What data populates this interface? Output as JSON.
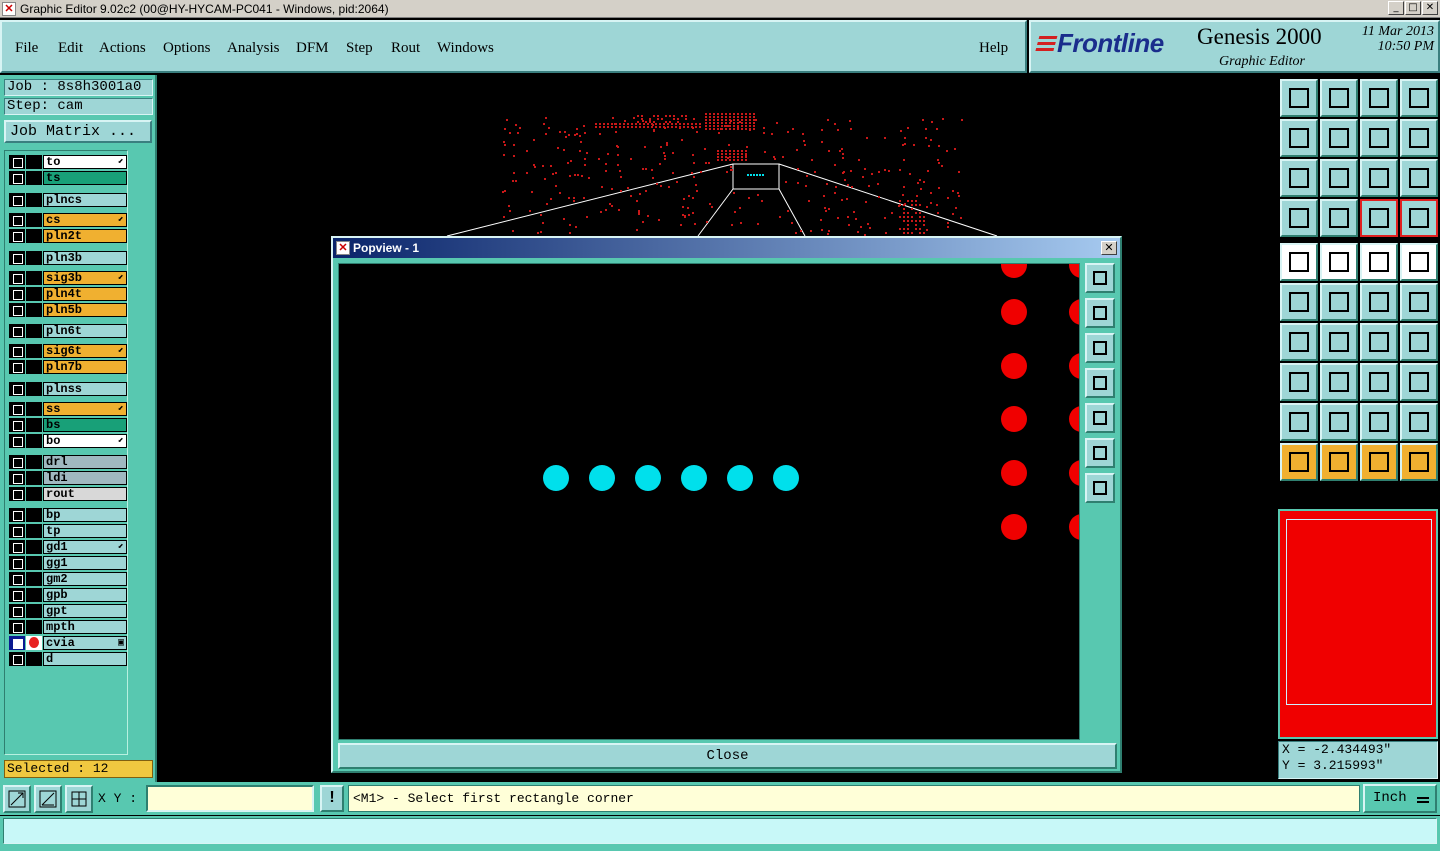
{
  "window": {
    "title": "Graphic Editor 9.02c2 (00@HY-HYCAM-PC041 - Windows, pid:2064)",
    "minimize": "_",
    "maximize": "□",
    "close": "✕"
  },
  "menu": [
    {
      "label": "File"
    },
    {
      "label": "Edit"
    },
    {
      "label": "Actions"
    },
    {
      "label": "Options"
    },
    {
      "label": "Analysis"
    },
    {
      "label": "DFM"
    },
    {
      "label": "Step"
    },
    {
      "label": "Rout"
    },
    {
      "label": "Windows"
    }
  ],
  "help_label": "Help",
  "brand": {
    "logo": "Frontline",
    "product": "Genesis 2000",
    "subtitle": "Graphic Editor",
    "date": "11 Mar 2013",
    "time": "10:50 PM"
  },
  "left": {
    "job": "Job : 8s8h3001a0",
    "step": "Step: cam",
    "job_matrix": "Job Matrix ...",
    "selected": "Selected : 12",
    "layers": [
      {
        "name": "to",
        "color": "#ffffff",
        "mark": "⬋"
      },
      {
        "name": "ts",
        "color": "#18a078",
        "mark": ""
      },
      {
        "name": "plncs",
        "color": "#9ed6d6",
        "mark": ""
      },
      {
        "name": "cs",
        "color": "#f0b030",
        "mark": "⬋"
      },
      {
        "name": "pln2t",
        "color": "#f0b030",
        "mark": ""
      },
      {
        "name": "pln3b",
        "color": "#9ed6d6",
        "mark": ""
      },
      {
        "name": "sig3b",
        "color": "#f0b030",
        "mark": "⬋"
      },
      {
        "name": "pln4t",
        "color": "#f0b030",
        "mark": ""
      },
      {
        "name": "pln5b",
        "color": "#f0b030",
        "mark": ""
      },
      {
        "name": "pln6t",
        "color": "#9ed6d6",
        "mark": ""
      },
      {
        "name": "sig6t",
        "color": "#f0b030",
        "mark": "⬋"
      },
      {
        "name": "pln7b",
        "color": "#f0b030",
        "mark": ""
      },
      {
        "name": "plnss",
        "color": "#9ed6d6",
        "mark": ""
      },
      {
        "name": "ss",
        "color": "#f0b030",
        "mark": "⬋"
      },
      {
        "name": "bs",
        "color": "#18a078",
        "mark": ""
      },
      {
        "name": "bo",
        "color": "#ffffff",
        "mark": "⬋"
      },
      {
        "name": "drl",
        "color": "#a0b8c0",
        "mark": ""
      },
      {
        "name": "ldi",
        "color": "#a0b8c0",
        "mark": ""
      },
      {
        "name": "rout",
        "color": "#d8d8d8",
        "mark": ""
      },
      {
        "name": "bp",
        "color": "#9ed6d6",
        "mark": ""
      },
      {
        "name": "tp",
        "color": "#9ed6d6",
        "mark": ""
      },
      {
        "name": "gd1",
        "color": "#9ed6d6",
        "mark": "⬋"
      },
      {
        "name": "gg1",
        "color": "#9ed6d6",
        "mark": ""
      },
      {
        "name": "gm2",
        "color": "#9ed6d6",
        "mark": ""
      },
      {
        "name": "gpb",
        "color": "#9ed6d6",
        "mark": ""
      },
      {
        "name": "gpt",
        "color": "#9ed6d6",
        "mark": ""
      },
      {
        "name": "mpth",
        "color": "#9ed6d6",
        "mark": ""
      },
      {
        "name": "cvia",
        "color": "#9ed6d6",
        "mark": "▣"
      },
      {
        "name": "d",
        "color": "#9ed6d6",
        "mark": ""
      }
    ]
  },
  "popview": {
    "title": "Popview - 1",
    "close_label": "Close"
  },
  "coords": {
    "x": "X = -2.434493\"",
    "y": "Y = 3.215993\""
  },
  "bottom": {
    "xy_label": "X Y :",
    "xy_value": "",
    "exclaim": "!",
    "prompt": "<M1> - Select first rectangle corner",
    "units": "Inch"
  }
}
